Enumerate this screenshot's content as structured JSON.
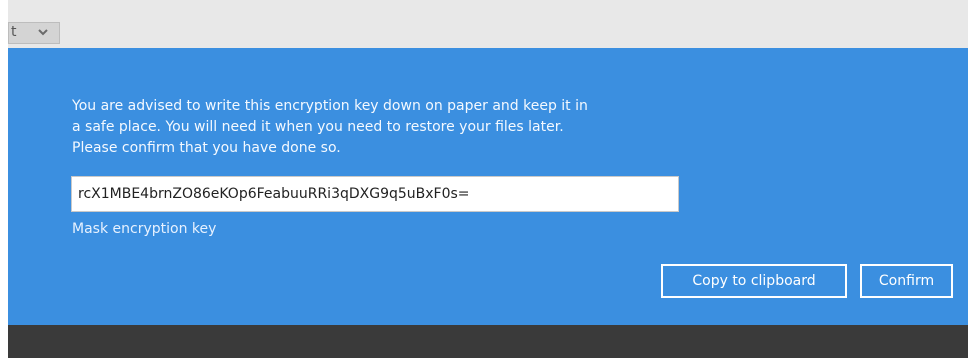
{
  "background": {
    "select_value": "t",
    "select_icon": "chevron-down-icon"
  },
  "dialog": {
    "message_lines": [
      "You are advised to write this encryption key down on paper and keep it in",
      "a safe place. You will need it when you need to restore your files later.",
      "Please confirm that you have done so."
    ],
    "encryption_key": "rcX1MBE4brnZO86eKOp6FeabuuRRi3qDXG9q5uBxF0s=",
    "mask_link_label": "Mask encryption key",
    "copy_button_label": "Copy to clipboard",
    "confirm_button_label": "Confirm"
  },
  "colors": {
    "dialog_bg": "#3b8fe0",
    "overlay_bg": "#3a3a3a",
    "text": "#ffffff"
  }
}
